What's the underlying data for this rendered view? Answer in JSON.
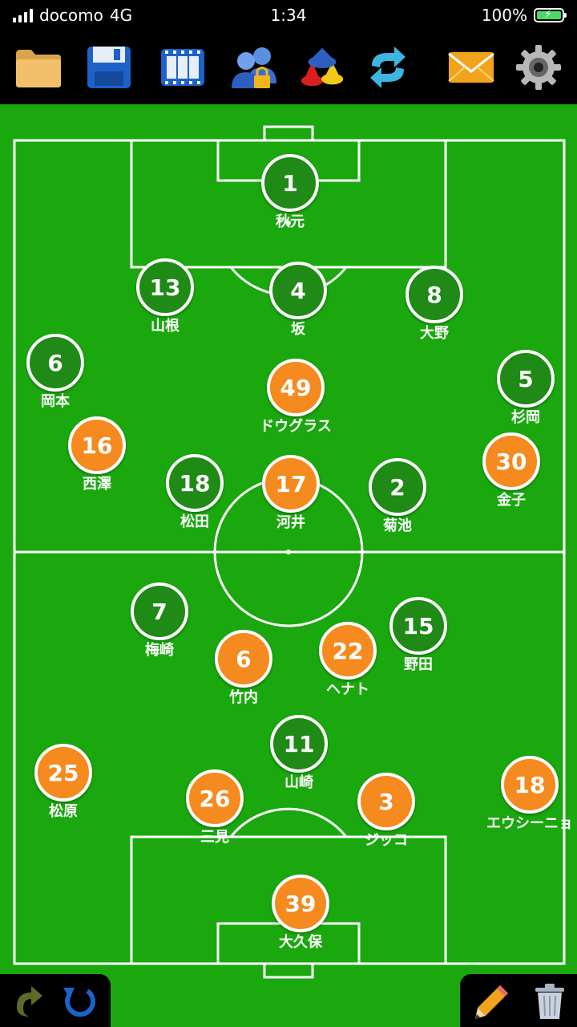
{
  "status": {
    "carrier": "docomo",
    "network": "4G",
    "time": "1:34",
    "battery": "100%"
  },
  "toolbar": {
    "buttons": [
      {
        "icon": "folder-icon",
        "name": "open-button"
      },
      {
        "icon": "save-icon",
        "name": "save-button"
      },
      {
        "icon": "film-icon",
        "name": "animation-button"
      },
      {
        "icon": "team-lock-icon",
        "name": "team-button"
      },
      {
        "icon": "markers-icon",
        "name": "markers-button"
      },
      {
        "icon": "sync-icon",
        "name": "flip-button"
      },
      {
        "icon": "mail-icon",
        "name": "mail-button"
      },
      {
        "icon": "gear-icon",
        "name": "settings-button"
      }
    ]
  },
  "players": [
    {
      "number": "1",
      "name": "秋元",
      "team": "green"
    },
    {
      "number": "13",
      "name": "山根",
      "team": "green"
    },
    {
      "number": "4",
      "name": "坂",
      "team": "green"
    },
    {
      "number": "8",
      "name": "大野",
      "team": "green"
    },
    {
      "number": "6",
      "name": "岡本",
      "team": "green"
    },
    {
      "number": "49",
      "name": "ドウグラス",
      "team": "orange"
    },
    {
      "number": "5",
      "name": "杉岡",
      "team": "green"
    },
    {
      "number": "16",
      "name": "西澤",
      "team": "orange"
    },
    {
      "number": "30",
      "name": "金子",
      "team": "orange"
    },
    {
      "number": "18",
      "name": "松田",
      "team": "green"
    },
    {
      "number": "17",
      "name": "河井",
      "team": "orange"
    },
    {
      "number": "2",
      "name": "菊池",
      "team": "green"
    },
    {
      "number": "7",
      "name": "梅崎",
      "team": "green"
    },
    {
      "number": "15",
      "name": "野田",
      "team": "green"
    },
    {
      "number": "6",
      "name": "竹内",
      "team": "orange"
    },
    {
      "number": "22",
      "name": "ヘナト",
      "team": "orange"
    },
    {
      "number": "11",
      "name": "山崎",
      "team": "green"
    },
    {
      "number": "25",
      "name": "松原",
      "team": "orange"
    },
    {
      "number": "26",
      "name": "三見",
      "team": "orange"
    },
    {
      "number": "3",
      "name": "ジッコ",
      "team": "orange"
    },
    {
      "number": "18",
      "name": "エウシーニョ",
      "team": "orange"
    },
    {
      "number": "39",
      "name": "大久保",
      "team": "orange"
    }
  ],
  "bottom": {
    "left": [
      {
        "icon": "redo-icon"
      },
      {
        "icon": "undo-icon"
      }
    ],
    "right": [
      {
        "icon": "pencil-icon"
      },
      {
        "icon": "trash-icon"
      }
    ]
  },
  "colors": {
    "field": "#1aa80e",
    "green_team": "#1f8a16",
    "orange_team": "#f58a1e"
  }
}
